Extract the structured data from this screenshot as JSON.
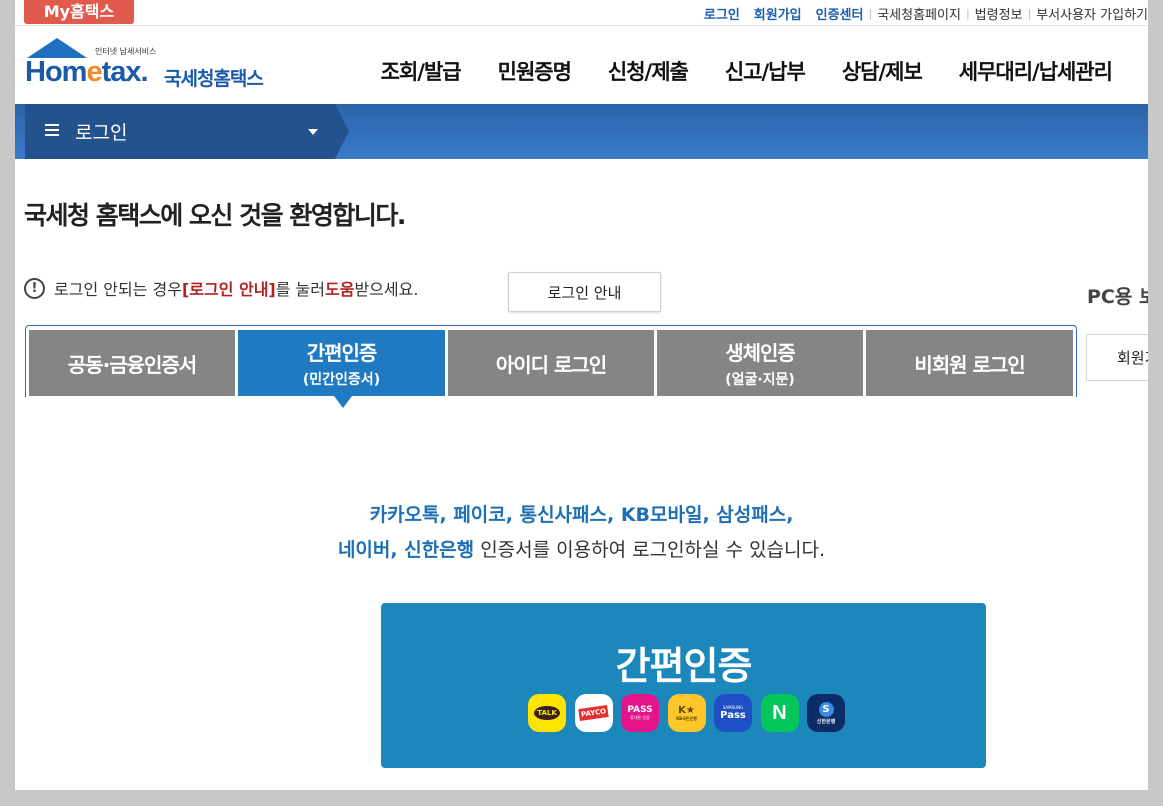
{
  "util": {
    "my_hometax": "My홈택스",
    "login": "로그인",
    "signup": "회원가입",
    "cert_center": "인증센터",
    "nts_page": "국세청홈페이지",
    "law_info": "법령정보",
    "dept_join": "부서사용자 가입하기"
  },
  "logo": {
    "small": "인터넷 납세서비스",
    "word_a": "Hom",
    "word_e": "e",
    "word_b": "tax.",
    "korean": "국세청홈택스"
  },
  "gnb": [
    "조회/발급",
    "민원증명",
    "신청/제출",
    "신고/납부",
    "상담/제보",
    "세무대리/납세관리"
  ],
  "nav": {
    "current": "로그인"
  },
  "welcome": "국세청 홈택스에 오신 것을 환영합니다.",
  "notice": {
    "icon_symbol": "!",
    "text1": "로그인 안되는 경우 ",
    "link_text": "[로그인 안내]",
    "text2": "를 눌러 ",
    "help": "도움",
    "text3": "받으세요.",
    "button": "로그인 안내"
  },
  "side": {
    "pc_text": "PC용 보안",
    "button": "회원가입"
  },
  "tabs": [
    {
      "label": "공동·금융인증서",
      "sub": ""
    },
    {
      "label": "간편인증",
      "sub": "(민간인증서)"
    },
    {
      "label": "아이디 로그인",
      "sub": ""
    },
    {
      "label": "생체인증",
      "sub": "(얼굴·지문)"
    },
    {
      "label": "비회원 로그인",
      "sub": ""
    }
  ],
  "intro": {
    "line1": "카카오톡, 페이코, 통신사패스, KB모바일, 삼성패스,",
    "line2_hl": "네이버, 신한은행",
    "line2_rest": " 인증서를 이용하여 로그인하실 수 있습니다."
  },
  "easy_login": {
    "title": "간편인증",
    "providers": [
      {
        "name": "kakao-icon",
        "label": "TALK"
      },
      {
        "name": "payco-icon",
        "label": "PAYCO"
      },
      {
        "name": "pass-icon",
        "label": "PASS",
        "sub": "휴대폰 인증"
      },
      {
        "name": "kb-icon",
        "label": "K★",
        "sub": "KB국민은행"
      },
      {
        "name": "samsung-pass-icon",
        "label": "Pass",
        "sub": "SAMSUNG"
      },
      {
        "name": "naver-icon",
        "label": "N"
      },
      {
        "name": "shinhan-icon",
        "label": "S",
        "sub": "신한은행"
      }
    ]
  },
  "colors": {
    "brand_blue": "#1f7ac2",
    "tab_gray": "#858585",
    "button_blue": "#1b87bb",
    "alert_red": "#b22222"
  }
}
